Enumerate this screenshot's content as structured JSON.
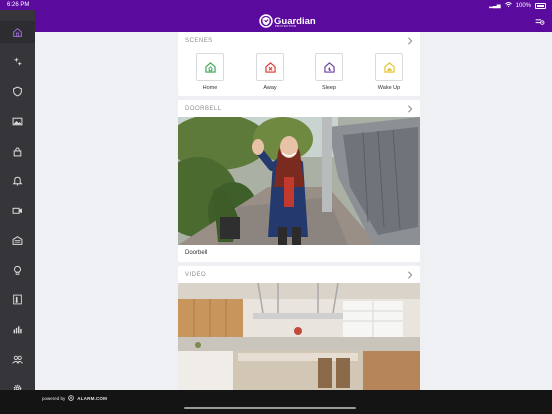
{
  "status": {
    "time": "6:26 PM",
    "battery": "100%"
  },
  "header": {
    "brand": "Guardian",
    "brand_sub": "PROTECTION"
  },
  "sidebar": {
    "items": [
      {
        "name": "home",
        "icon": "home-icon",
        "active": true
      },
      {
        "name": "scenes",
        "icon": "scenes-sparkle-icon"
      },
      {
        "name": "security",
        "icon": "shield-icon"
      },
      {
        "name": "images",
        "icon": "image-icon"
      },
      {
        "name": "locks",
        "icon": "lock-icon"
      },
      {
        "name": "notifications",
        "icon": "bell-icon"
      },
      {
        "name": "video",
        "icon": "video-camera-icon"
      },
      {
        "name": "garage",
        "icon": "garage-icon"
      },
      {
        "name": "lights",
        "icon": "lightbulb-icon"
      },
      {
        "name": "thermostat",
        "icon": "thermostat-icon"
      },
      {
        "name": "activity",
        "icon": "bar-chart-icon"
      },
      {
        "name": "users",
        "icon": "users-icon"
      },
      {
        "name": "settings",
        "icon": "gear-icon"
      }
    ]
  },
  "scenes": {
    "title": "SCENES",
    "items": [
      {
        "label": "Home",
        "color": "#3aa655",
        "icon": "house-home-icon"
      },
      {
        "label": "Away",
        "color": "#d9342b",
        "icon": "house-away-icon"
      },
      {
        "label": "Sleep",
        "color": "#6b3fa0",
        "icon": "house-sleep-icon"
      },
      {
        "label": "Wake Up",
        "color": "#e6c02a",
        "icon": "house-wake-icon"
      }
    ]
  },
  "doorbell": {
    "title": "DOORBELL",
    "label": "Doorbell"
  },
  "video": {
    "title": "VIDEO"
  },
  "footer": {
    "powered_by": "powered by",
    "brand": "ALARM.COM"
  },
  "colors": {
    "brand_purple": "#5a0b9e",
    "sidebar": "#36363a"
  }
}
